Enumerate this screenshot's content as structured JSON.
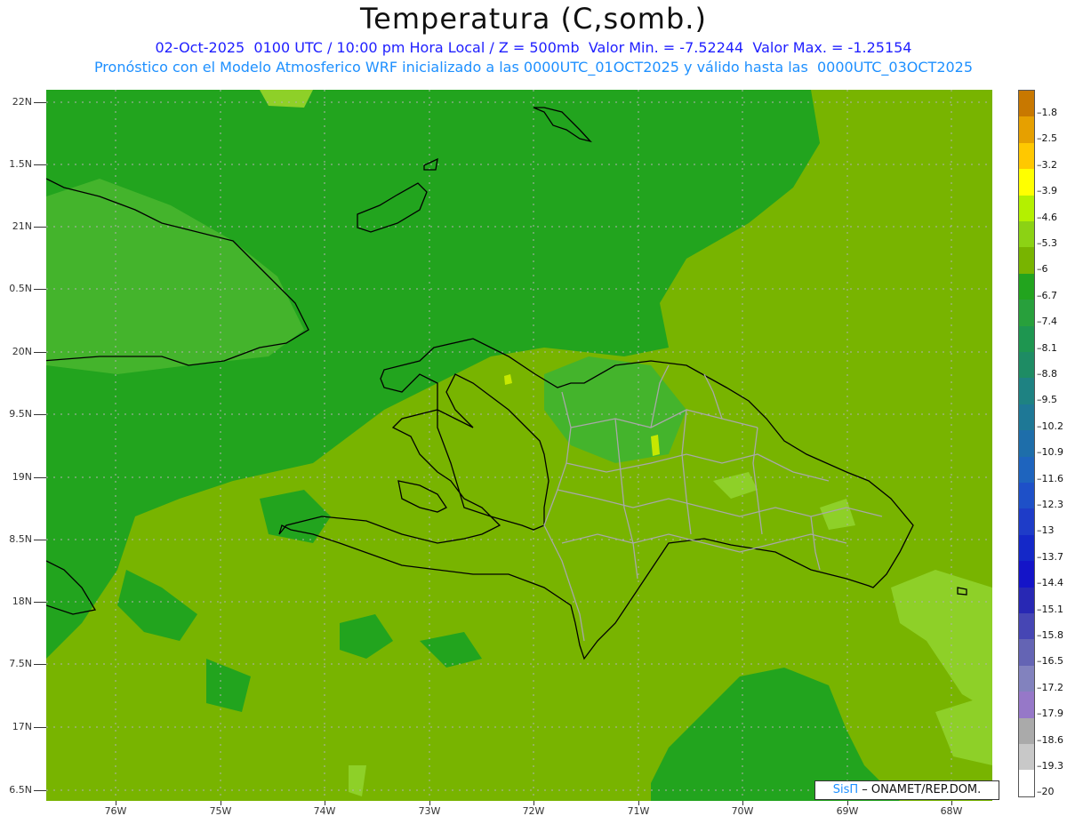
{
  "title": "Temperatura (C,somb.)",
  "subtitle_line1": "02-Oct-2025  0100 UTC / 10:00 pm Hora Local / Z = 500mb  Valor Min. = -7.52244  Valor Max. = -1.25154",
  "subtitle_line2": "Pronóstico con el Modelo Atmosferico WRF inicializado a las 0000UTC_01OCT2025 y válido hasta las  0000UTC_03OCT2025",
  "credit": {
    "sis": "SisΠ",
    "rest": "– ONAMET/REP.DOM."
  },
  "map": {
    "lon_range": [
      -76.65,
      -67.6
    ],
    "lat_range": [
      16.4,
      22.1
    ],
    "lat_labels": [
      "22N",
      "1.5N",
      "21N",
      "0.5N",
      "20N",
      "9.5N",
      "19N",
      "8.5N",
      "18N",
      "7.5N",
      "17N",
      "6.5N"
    ],
    "lon_labels": [
      "76W",
      "75W",
      "74W",
      "73W",
      "72W",
      "71W",
      "70W",
      "69W",
      "68W"
    ],
    "background_color": "#78b400",
    "field_colors": {
      "dark": "#22a41e",
      "mid": "#44b42c",
      "light": "#8ed028",
      "yellow": "#c6e800"
    }
  },
  "colorbar": {
    "labels": [
      "-1.8",
      "-2.5",
      "-3.2",
      "-3.9",
      "-4.6",
      "-5.3",
      "-6",
      "-6.7",
      "-7.4",
      "-8.1",
      "-8.8",
      "-9.5",
      "-10.2",
      "-10.9",
      "-11.6",
      "-12.3",
      "-13",
      "-13.7",
      "-14.4",
      "-15.1",
      "-15.8",
      "-16.5",
      "-17.2",
      "-17.9",
      "-18.6",
      "-19.3",
      "-20"
    ],
    "colors": [
      "#c87800",
      "#e6a000",
      "#ffc800",
      "#ffff00",
      "#b4f000",
      "#8cd214",
      "#78b400",
      "#22a41e",
      "#28a03c",
      "#1e9650",
      "#1e8c64",
      "#1e8282",
      "#1e7896",
      "#1e6eaa",
      "#1e64be",
      "#1e50c8",
      "#1e3cc8",
      "#1428c8",
      "#1414c8",
      "#2828b4",
      "#4646b4",
      "#6464b4",
      "#8282be",
      "#9678c8",
      "#aaaaaa",
      "#c8c8c8",
      "#ffffff"
    ]
  }
}
